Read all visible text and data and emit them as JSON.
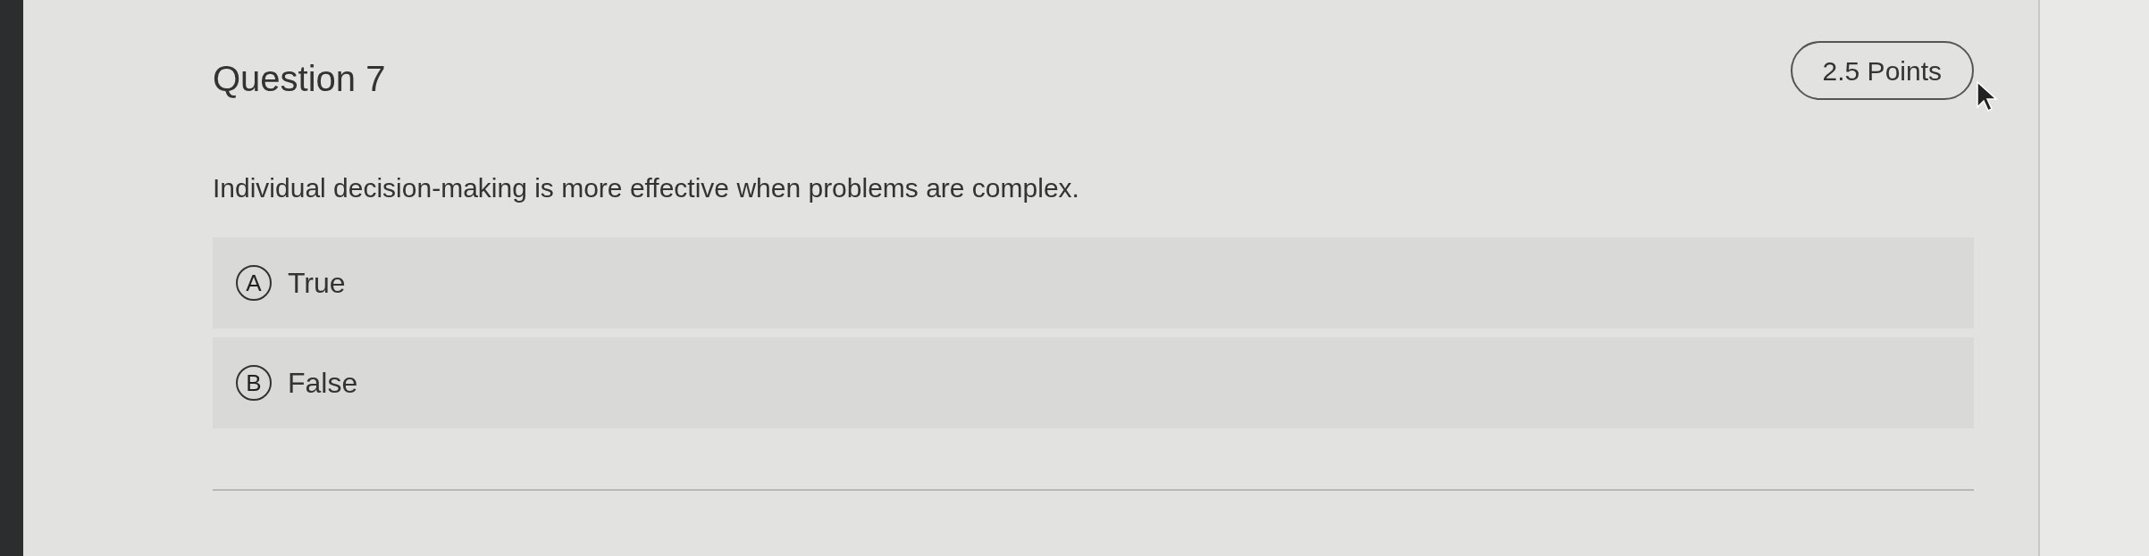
{
  "question": {
    "title": "Question 7",
    "points": "2.5 Points",
    "statement": "Individual decision-making is more effective when problems are complex.",
    "options": [
      {
        "letter": "A",
        "text": "True"
      },
      {
        "letter": "B",
        "text": "False"
      }
    ]
  }
}
